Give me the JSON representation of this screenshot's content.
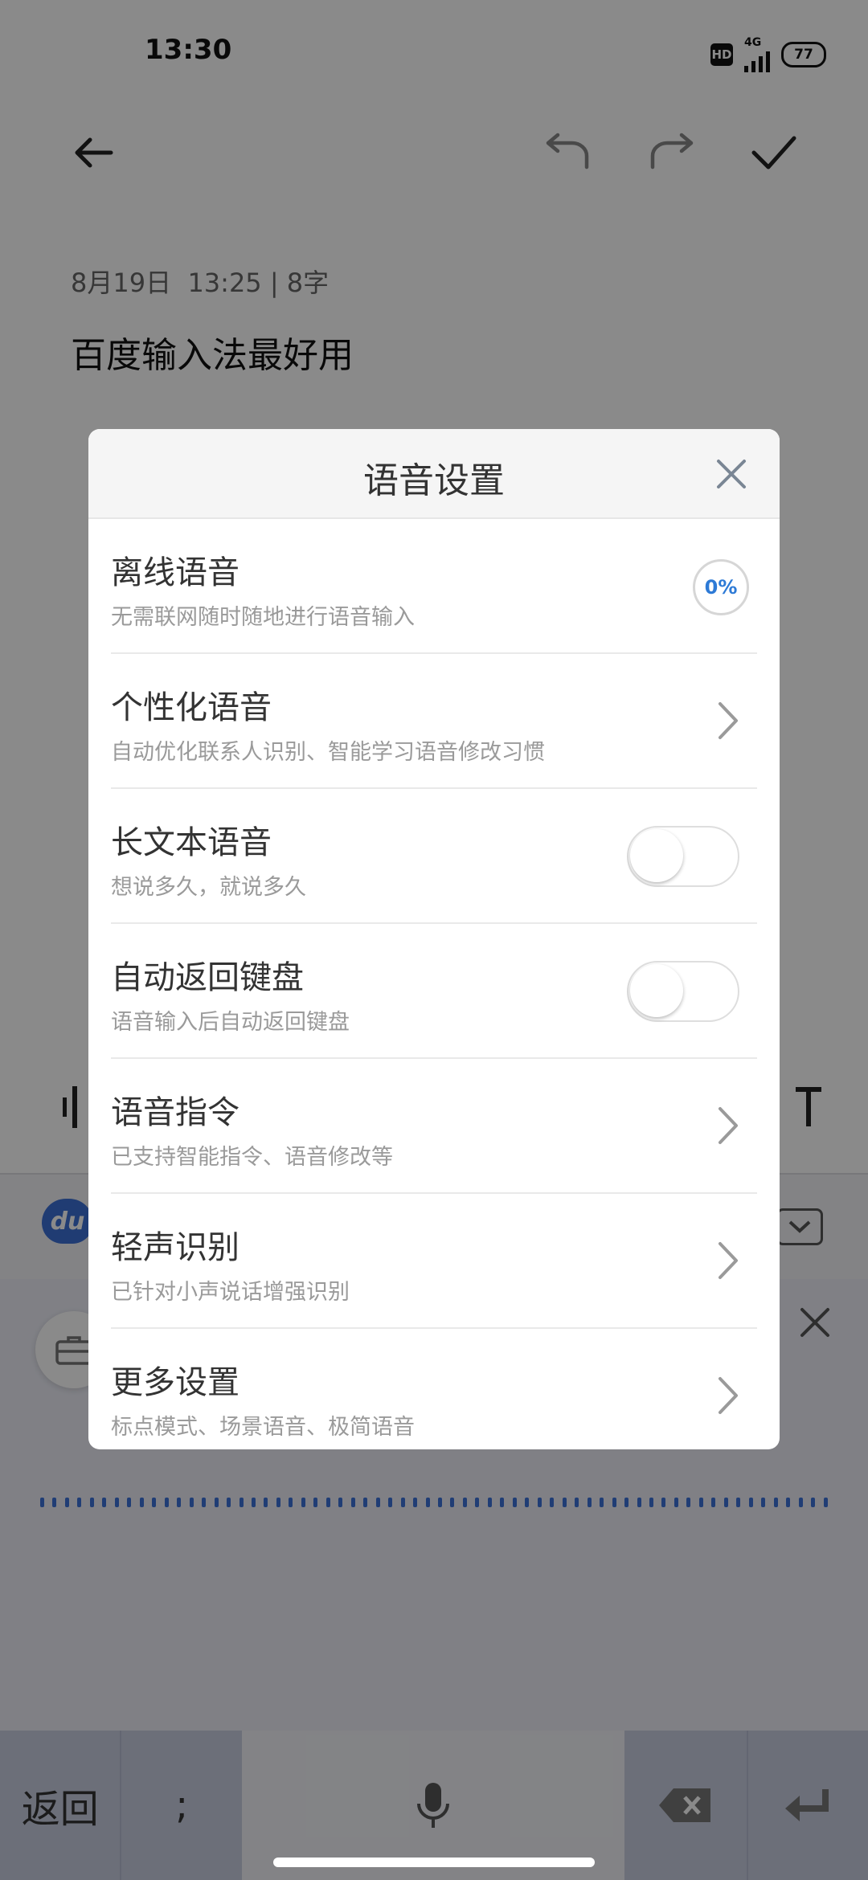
{
  "status_bar": {
    "time": "13:30",
    "hd": "HD",
    "network": "4G",
    "battery": "77"
  },
  "note": {
    "date": "8月19日",
    "time": "13:25",
    "separator": "|",
    "word_count": "8字",
    "content": "百度输入法最好用"
  },
  "keyboard": {
    "logo": "du",
    "keys": {
      "back": "返回",
      "punct": ";"
    }
  },
  "dialog": {
    "title": "语音设置",
    "items": [
      {
        "title": "离线语音",
        "subtitle": "无需联网随时随地进行语音输入",
        "control": "progress",
        "progress": "0%"
      },
      {
        "title": "个性化语音",
        "subtitle": "自动优化联系人识别、智能学习语音修改习惯",
        "control": "chevron"
      },
      {
        "title": "长文本语音",
        "subtitle": "想说多久，就说多久",
        "control": "toggle",
        "on": false
      },
      {
        "title": "自动返回键盘",
        "subtitle": "语音输入后自动返回键盘",
        "control": "toggle",
        "on": false
      },
      {
        "title": "语音指令",
        "subtitle": "已支持智能指令、语音修改等",
        "control": "chevron"
      },
      {
        "title": "轻声识别",
        "subtitle": "已针对小声说话增强识别",
        "control": "chevron"
      },
      {
        "title": "更多设置",
        "subtitle": "标点模式、场景语音、极简语音",
        "control": "chevron"
      }
    ]
  },
  "colors": {
    "accent": "#2d7ad6",
    "wave": "#3b72d8"
  }
}
